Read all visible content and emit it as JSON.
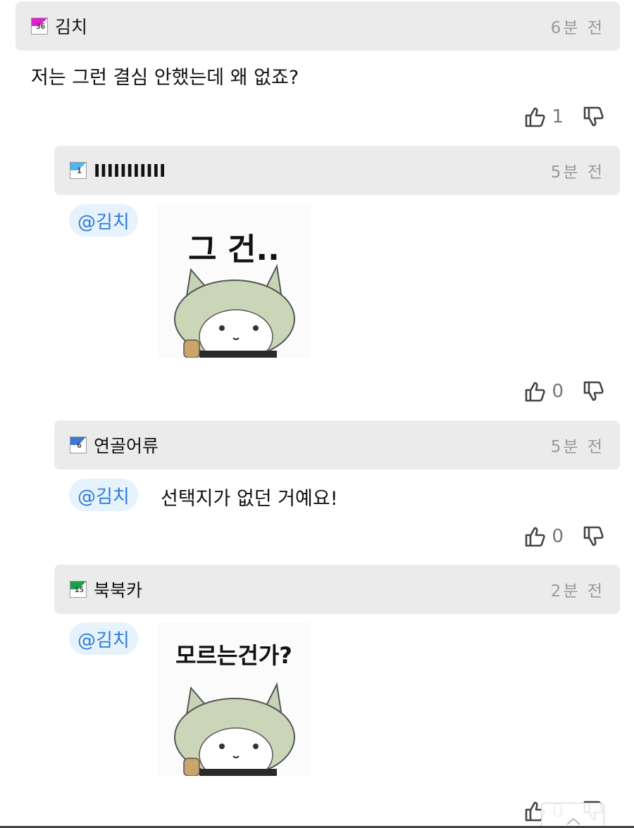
{
  "comments": [
    {
      "level": "36",
      "level_color": "#e020d0",
      "nickname": "김치",
      "time": "6분 전",
      "text": "저는 그런 결심 안했는데 왜 없죠?",
      "likes": "1"
    },
    {
      "level": "1",
      "level_color": "#4fb4f0",
      "nickname": "IIIIIIIIIII",
      "time": "5분 전",
      "mention": "@김치",
      "sticker_caption": "그 건..",
      "likes": "0"
    },
    {
      "level": "6",
      "level_color": "#3a78d8",
      "nickname": "연골어류",
      "time": "5분 전",
      "mention": "@김치",
      "text": "선택지가 없던 거예요!",
      "likes": "0"
    },
    {
      "level": "15",
      "level_color": "#1aa04a",
      "nickname": "북북카",
      "time": "2분 전",
      "mention": "@김치",
      "sticker_caption": "모르는건가?",
      "likes": "0"
    }
  ],
  "icons": {
    "like": "thumbs-up-icon",
    "dislike": "thumbs-down-icon"
  }
}
